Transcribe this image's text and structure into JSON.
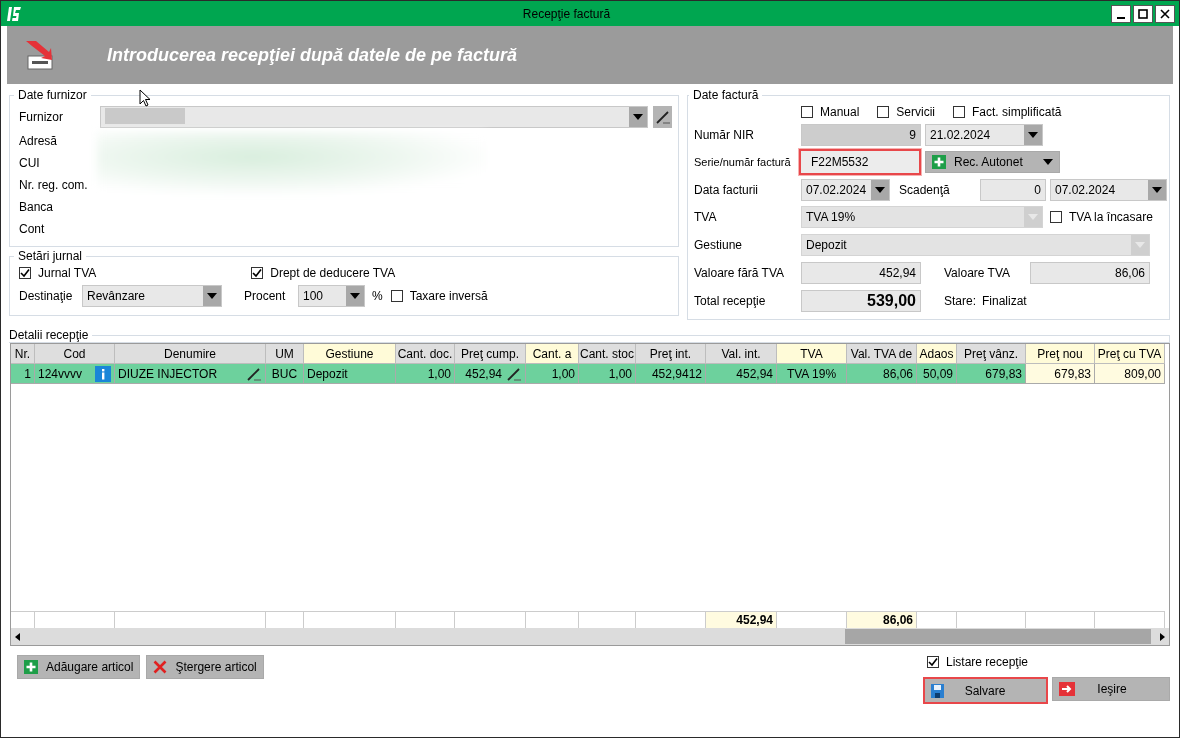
{
  "window": {
    "title": "Recepţie factură"
  },
  "banner": {
    "heading": "Introducerea recepţiei după datele de pe factură"
  },
  "supplier": {
    "title": "Date furnizor",
    "supplier_label": "Furnizor",
    "labels": [
      "Adresă",
      "CUI",
      "Nr. reg. com.",
      "Banca",
      "Cont"
    ]
  },
  "journal": {
    "title": "Setări jurnal",
    "vat_journal": {
      "label": "Jurnal TVA",
      "checked": true
    },
    "deduction": {
      "label": "Drept de deducere TVA",
      "checked": true
    },
    "destination": {
      "label": "Destinaţie",
      "value": "Revânzare"
    },
    "percent": {
      "label": "Procent",
      "value": "100",
      "unit": "%"
    },
    "reverse_charge": {
      "label": "Taxare inversă",
      "checked": false
    }
  },
  "invoice": {
    "title": "Date factură",
    "options": [
      {
        "label": "Manual",
        "checked": false
      },
      {
        "label": "Servicii",
        "checked": false
      },
      {
        "label": "Fact. simplificată",
        "checked": false
      }
    ],
    "nir": {
      "label": "Număr NIR",
      "number": "9",
      "date": "21.02.2024"
    },
    "invoice_number": {
      "label": "Serie/număr factură",
      "value": "F22M5532",
      "highlighted": true
    },
    "rec_button": {
      "label": "Rec. Autonet"
    },
    "invoice_date": {
      "label": "Data facturii",
      "value": "07.02.2024"
    },
    "due": {
      "label": "Scadenţă",
      "days": "0",
      "date": "07.02.2024"
    },
    "vat": {
      "label": "TVA",
      "value": "TVA 19%",
      "disabled": true
    },
    "vat_on_cash": {
      "label": "TVA la încasare",
      "checked": false
    },
    "stock": {
      "label": "Gestiune",
      "value": "Depozit",
      "disabled": true
    },
    "net_value": {
      "label": "Valoare fără TVA",
      "value": "452,94"
    },
    "vat_value": {
      "label": "Valoare TVA",
      "value": "86,06"
    },
    "total": {
      "label": "Total recepţie",
      "value": "539,00"
    },
    "status": {
      "label": "Stare:",
      "value": "Finalizat"
    }
  },
  "details": {
    "title": "Detalii recepţie",
    "columns": [
      {
        "label": "Nr.",
        "kind": "number",
        "editable": false,
        "input": false
      },
      {
        "label": "Cod",
        "kind": "info",
        "editable": false,
        "input": false
      },
      {
        "label": "Denumire",
        "kind": "edit",
        "editable": false,
        "input": false
      },
      {
        "label": "UM",
        "kind": "center",
        "editable": false,
        "input": false
      },
      {
        "label": "Gestiune",
        "kind": "text",
        "editable": true,
        "input": false
      },
      {
        "label": "Cant. doc.",
        "kind": "number",
        "editable": false,
        "input": false
      },
      {
        "label": "Preţ cump.",
        "kind": "number_edit",
        "editable": false,
        "input": false
      },
      {
        "label": "Cant. a",
        "kind": "number",
        "editable": true,
        "input": false
      },
      {
        "label": "Cant. stoc",
        "kind": "number",
        "editable": false,
        "input": false
      },
      {
        "label": "Preţ int.",
        "kind": "number",
        "editable": false,
        "input": false
      },
      {
        "label": "Val. int.",
        "kind": "number",
        "editable": false,
        "input": false,
        "total": "452,94"
      },
      {
        "label": "TVA",
        "kind": "center",
        "editable": true,
        "input": false
      },
      {
        "label": "Val. TVA de",
        "kind": "number",
        "editable": false,
        "input": false,
        "total": "86,06"
      },
      {
        "label": "Adaos",
        "kind": "number",
        "editable": true,
        "input": false
      },
      {
        "label": "Preţ vânz.",
        "kind": "number",
        "editable": false,
        "input": false
      },
      {
        "label": "Preţ nou",
        "kind": "number",
        "editable": true,
        "input": true
      },
      {
        "label": "Preţ cu TVA",
        "kind": "number",
        "editable": true,
        "input": true
      }
    ],
    "rows": [
      {
        "selected": true,
        "cells": [
          "1",
          "124vvvv",
          "DIUZE INJECTOR",
          "BUC",
          "Depozit",
          "1,00",
          "452,94",
          "1,00",
          "1,00",
          "452,9412",
          "452,94",
          "TVA 19%",
          "86,06",
          "50,09",
          "679,83",
          "679,83",
          "809,00"
        ]
      }
    ]
  },
  "actions": [
    {
      "label": "Adăugare articol",
      "kind": "add"
    },
    {
      "label": "Ştergere articol",
      "kind": "delete"
    }
  ],
  "print_option": {
    "label": "Listare recepţie",
    "checked": true
  },
  "buttons": [
    {
      "label": "Salvare",
      "kind": "save",
      "highlighted": true
    },
    {
      "label": "Ieşire",
      "kind": "exit",
      "highlighted": false
    }
  ]
}
